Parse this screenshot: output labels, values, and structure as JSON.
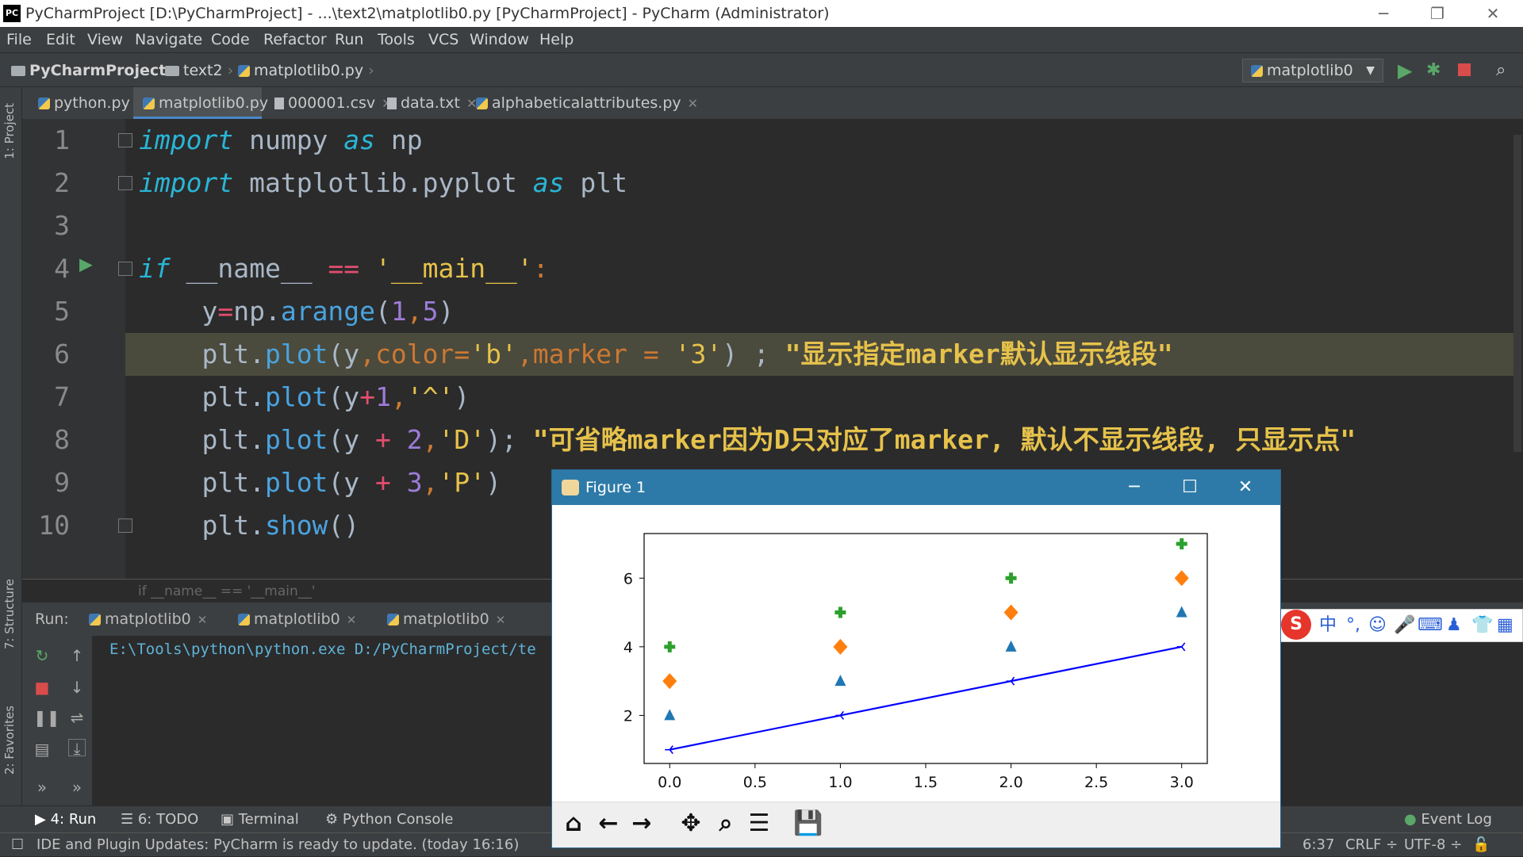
{
  "window": {
    "title": "PyCharmProject [D:\\PyCharmProject] - ...\\text2\\matplotlib0.py [PyCharmProject] - PyCharm (Administrator)",
    "app_icon": "PC"
  },
  "menu": [
    "File",
    "Edit",
    "View",
    "Navigate",
    "Code",
    "Refactor",
    "Run",
    "Tools",
    "VCS",
    "Window",
    "Help"
  ],
  "navbar": {
    "crumbs": [
      "PyCharmProject",
      "text2",
      "matplotlib0.py"
    ],
    "run_config": "matplotlib0"
  },
  "tabs": [
    {
      "label": "python.py",
      "active": false
    },
    {
      "label": "matplotlib0.py",
      "active": true
    },
    {
      "label": "000001.csv",
      "active": false
    },
    {
      "label": "data.txt",
      "active": false
    },
    {
      "label": "alphabeticalattributes.py",
      "active": false
    }
  ],
  "side_labels": {
    "project": "1: Project",
    "structure": "7: Structure",
    "favorites": "2: Favorites"
  },
  "code": {
    "line_numbers": [
      "1",
      "2",
      "3",
      "4",
      "5",
      "6",
      "7",
      "8",
      "9",
      "10"
    ],
    "l1": {
      "kw1": "import",
      "mod": " numpy ",
      "kw2": "as",
      "alias": " np"
    },
    "l2": {
      "kw1": "import",
      "mod": " matplotlib.pyplot ",
      "kw2": "as",
      "alias": " plt"
    },
    "l4": {
      "kw": "if",
      "name": " __name__ ",
      "op": "==",
      "str": " '__main__'",
      "colon": ":"
    },
    "l5": {
      "a": "    y",
      "eq": "=",
      "b": "np.",
      "fn": "arange",
      "p1": "(",
      "n1": "1",
      ",": ",",
      "n2": "5",
      "p2": ")"
    },
    "l6": {
      "a": "    plt.",
      "fn": "plot",
      "p1": "(y",
      "c1": ",",
      "kw": "color=",
      "s1": "'b'",
      "c2": ",",
      "kw2": "marker = ",
      "s2": "'3'",
      "p2": ") ; ",
      "s3": "\"显示指定marker默认显示线段\""
    },
    "l7": {
      "a": "    plt.",
      "fn": "plot",
      "p1": "(y",
      "op": "+",
      "n": "1",
      "c": ",",
      "s": "'^'",
      "p2": ")"
    },
    "l8": {
      "a": "    plt.",
      "fn": "plot",
      "p1": "(y ",
      "op": "+",
      "n": " 2",
      "c": ",",
      "s": "'D'",
      "p2": "); ",
      "s3": "\"可省略marker因为D只对应了marker, 默认不显示线段, 只显示点\""
    },
    "l9": {
      "a": "    plt.",
      "fn": "plot",
      "p1": "(y ",
      "op": "+",
      "n": " 3",
      "c": ",",
      "s": "'P'",
      "p2": ")"
    },
    "l10": {
      "a": "    plt.",
      "fn": "show",
      "p": "()"
    }
  },
  "breadcrumb": "if __name__ == '__main__'",
  "run": {
    "label": "Run:",
    "tabs": [
      "matplotlib0",
      "matplotlib0",
      "matplotlib0"
    ],
    "console": "E:\\Tools\\python\\python.exe D:/PyCharmProject/te"
  },
  "bottom_tabs": [
    "4: Run",
    "6: TODO",
    "Terminal",
    "Python Console"
  ],
  "event_log": "Event Log",
  "status": {
    "message": "IDE and Plugin Updates: PyCharm is ready to update. (today 16:16)",
    "position": "6:37",
    "line_sep": "CRLF ÷",
    "encoding": "UTF-8 ÷"
  },
  "ime": {
    "logo": "S",
    "lang": "中"
  },
  "figure": {
    "title": "Figure 1"
  },
  "chart_data": {
    "type": "line",
    "x": [
      0,
      1,
      2,
      3
    ],
    "xticks": [
      "0.0",
      "0.5",
      "1.0",
      "1.5",
      "2.0",
      "2.5",
      "3.0"
    ],
    "yticks": [
      "2",
      "4",
      "6"
    ],
    "xlim": [
      -0.15,
      3.15
    ],
    "ylim": [
      0.6,
      7.3
    ],
    "grid": false,
    "series": [
      {
        "values": [
          1,
          2,
          3,
          4
        ],
        "color": "#0000ff",
        "marker": "tri_left",
        "line": true
      },
      {
        "values": [
          2,
          3,
          4,
          5
        ],
        "color": "#1f77b4",
        "marker": "triangle",
        "line": false
      },
      {
        "values": [
          3,
          4,
          5,
          6
        ],
        "color": "#ff7f0e",
        "marker": "diamond",
        "line": false
      },
      {
        "values": [
          4,
          5,
          6,
          7
        ],
        "color": "#2ca02c",
        "marker": "plus",
        "line": false
      }
    ]
  },
  "colors": {
    "accent": "#4a88c7",
    "editor_bg": "#2b2b2b",
    "figure_title": "#2d7aa8"
  }
}
